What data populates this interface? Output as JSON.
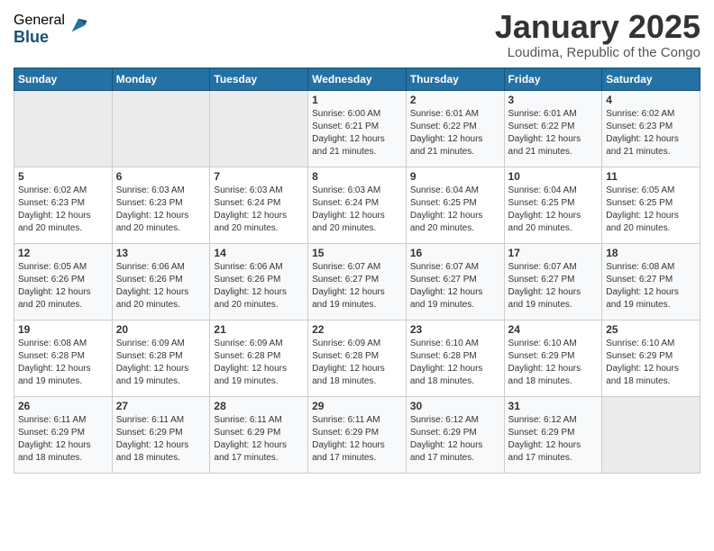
{
  "logo": {
    "general": "General",
    "blue": "Blue"
  },
  "title": "January 2025",
  "location": "Loudima, Republic of the Congo",
  "weekdays": [
    "Sunday",
    "Monday",
    "Tuesday",
    "Wednesday",
    "Thursday",
    "Friday",
    "Saturday"
  ],
  "weeks": [
    [
      {
        "day": "",
        "info": ""
      },
      {
        "day": "",
        "info": ""
      },
      {
        "day": "",
        "info": ""
      },
      {
        "day": "1",
        "info": "Sunrise: 6:00 AM\nSunset: 6:21 PM\nDaylight: 12 hours and 21 minutes."
      },
      {
        "day": "2",
        "info": "Sunrise: 6:01 AM\nSunset: 6:22 PM\nDaylight: 12 hours and 21 minutes."
      },
      {
        "day": "3",
        "info": "Sunrise: 6:01 AM\nSunset: 6:22 PM\nDaylight: 12 hours and 21 minutes."
      },
      {
        "day": "4",
        "info": "Sunrise: 6:02 AM\nSunset: 6:23 PM\nDaylight: 12 hours and 21 minutes."
      }
    ],
    [
      {
        "day": "5",
        "info": "Sunrise: 6:02 AM\nSunset: 6:23 PM\nDaylight: 12 hours and 20 minutes."
      },
      {
        "day": "6",
        "info": "Sunrise: 6:03 AM\nSunset: 6:23 PM\nDaylight: 12 hours and 20 minutes."
      },
      {
        "day": "7",
        "info": "Sunrise: 6:03 AM\nSunset: 6:24 PM\nDaylight: 12 hours and 20 minutes."
      },
      {
        "day": "8",
        "info": "Sunrise: 6:03 AM\nSunset: 6:24 PM\nDaylight: 12 hours and 20 minutes."
      },
      {
        "day": "9",
        "info": "Sunrise: 6:04 AM\nSunset: 6:25 PM\nDaylight: 12 hours and 20 minutes."
      },
      {
        "day": "10",
        "info": "Sunrise: 6:04 AM\nSunset: 6:25 PM\nDaylight: 12 hours and 20 minutes."
      },
      {
        "day": "11",
        "info": "Sunrise: 6:05 AM\nSunset: 6:25 PM\nDaylight: 12 hours and 20 minutes."
      }
    ],
    [
      {
        "day": "12",
        "info": "Sunrise: 6:05 AM\nSunset: 6:26 PM\nDaylight: 12 hours and 20 minutes."
      },
      {
        "day": "13",
        "info": "Sunrise: 6:06 AM\nSunset: 6:26 PM\nDaylight: 12 hours and 20 minutes."
      },
      {
        "day": "14",
        "info": "Sunrise: 6:06 AM\nSunset: 6:26 PM\nDaylight: 12 hours and 20 minutes."
      },
      {
        "day": "15",
        "info": "Sunrise: 6:07 AM\nSunset: 6:27 PM\nDaylight: 12 hours and 19 minutes."
      },
      {
        "day": "16",
        "info": "Sunrise: 6:07 AM\nSunset: 6:27 PM\nDaylight: 12 hours and 19 minutes."
      },
      {
        "day": "17",
        "info": "Sunrise: 6:07 AM\nSunset: 6:27 PM\nDaylight: 12 hours and 19 minutes."
      },
      {
        "day": "18",
        "info": "Sunrise: 6:08 AM\nSunset: 6:27 PM\nDaylight: 12 hours and 19 minutes."
      }
    ],
    [
      {
        "day": "19",
        "info": "Sunrise: 6:08 AM\nSunset: 6:28 PM\nDaylight: 12 hours and 19 minutes."
      },
      {
        "day": "20",
        "info": "Sunrise: 6:09 AM\nSunset: 6:28 PM\nDaylight: 12 hours and 19 minutes."
      },
      {
        "day": "21",
        "info": "Sunrise: 6:09 AM\nSunset: 6:28 PM\nDaylight: 12 hours and 19 minutes."
      },
      {
        "day": "22",
        "info": "Sunrise: 6:09 AM\nSunset: 6:28 PM\nDaylight: 12 hours and 18 minutes."
      },
      {
        "day": "23",
        "info": "Sunrise: 6:10 AM\nSunset: 6:28 PM\nDaylight: 12 hours and 18 minutes."
      },
      {
        "day": "24",
        "info": "Sunrise: 6:10 AM\nSunset: 6:29 PM\nDaylight: 12 hours and 18 minutes."
      },
      {
        "day": "25",
        "info": "Sunrise: 6:10 AM\nSunset: 6:29 PM\nDaylight: 12 hours and 18 minutes."
      }
    ],
    [
      {
        "day": "26",
        "info": "Sunrise: 6:11 AM\nSunset: 6:29 PM\nDaylight: 12 hours and 18 minutes."
      },
      {
        "day": "27",
        "info": "Sunrise: 6:11 AM\nSunset: 6:29 PM\nDaylight: 12 hours and 18 minutes."
      },
      {
        "day": "28",
        "info": "Sunrise: 6:11 AM\nSunset: 6:29 PM\nDaylight: 12 hours and 17 minutes."
      },
      {
        "day": "29",
        "info": "Sunrise: 6:11 AM\nSunset: 6:29 PM\nDaylight: 12 hours and 17 minutes."
      },
      {
        "day": "30",
        "info": "Sunrise: 6:12 AM\nSunset: 6:29 PM\nDaylight: 12 hours and 17 minutes."
      },
      {
        "day": "31",
        "info": "Sunrise: 6:12 AM\nSunset: 6:29 PM\nDaylight: 12 hours and 17 minutes."
      },
      {
        "day": "",
        "info": ""
      }
    ]
  ]
}
